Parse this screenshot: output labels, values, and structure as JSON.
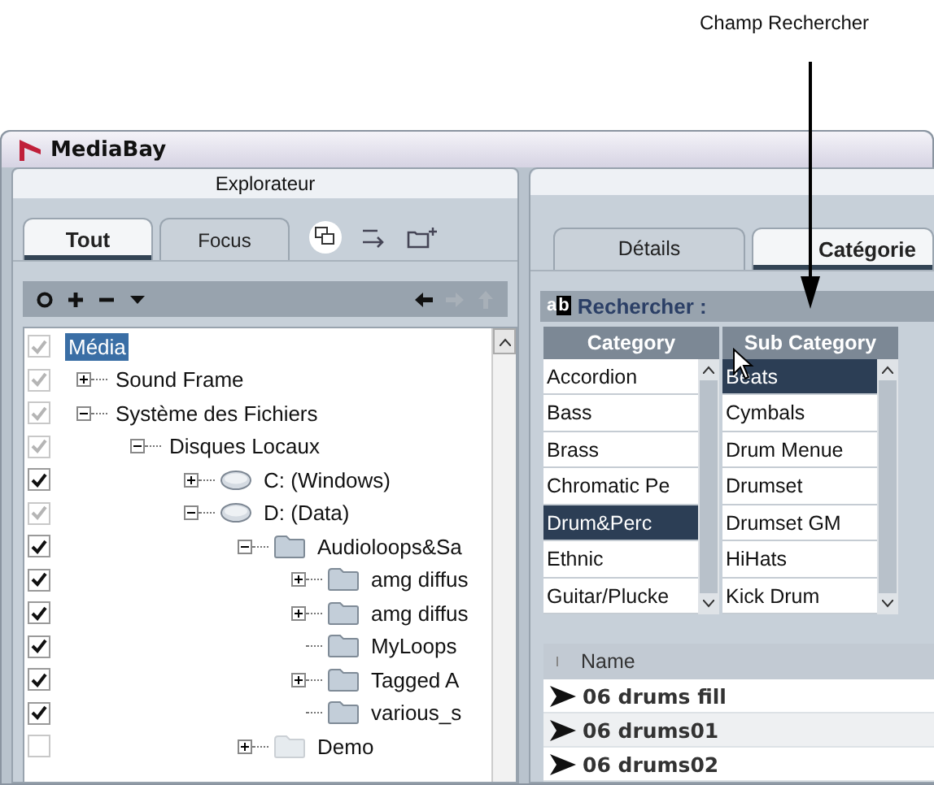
{
  "callout": {
    "label": "Champ Rechercher"
  },
  "window": {
    "title": "MediaBay"
  },
  "explorer": {
    "title": "Explorateur",
    "tabs": [
      {
        "label": "Tout",
        "selected": true
      },
      {
        "label": "Focus",
        "selected": false
      }
    ],
    "toolbar": [
      {
        "kind": "circle",
        "disabled": false
      },
      {
        "kind": "plus",
        "disabled": false
      },
      {
        "kind": "minus",
        "disabled": false
      },
      {
        "kind": "caret",
        "disabled": false
      },
      {
        "kind": "left",
        "disabled": false
      },
      {
        "kind": "right",
        "disabled": true
      },
      {
        "kind": "up",
        "disabled": true
      }
    ],
    "tree": [
      {
        "label": "Média",
        "checked": true,
        "disabled": true,
        "selected": true,
        "children": [
          {
            "label": "Sound Frame",
            "checked": true,
            "disabled": true,
            "selected": false,
            "expanded": false
          },
          {
            "label": "Système des Fichiers",
            "checked": true,
            "disabled": true,
            "selected": false,
            "expanded": true,
            "children": [
              {
                "label": "Disques Locaux",
                "checked": true,
                "disabled": true,
                "selected": false,
                "expanded": true,
                "children": [
                  {
                    "label": "C: (Windows)",
                    "kind": "drive",
                    "checked": true,
                    "disabled": false,
                    "selected": false,
                    "expanded": false
                  },
                  {
                    "label": "D: (Data)",
                    "kind": "drive",
                    "checked": true,
                    "disabled": true,
                    "selected": false,
                    "expanded": true,
                    "children": [
                      {
                        "label": "Audioloops&Sa",
                        "kind": "folder",
                        "checked": true,
                        "disabled": false,
                        "selected": false,
                        "expanded": true,
                        "children": [
                          {
                            "label": "amg diffus",
                            "kind": "folder",
                            "checked": true,
                            "disabled": false,
                            "selected": false,
                            "expanded": false
                          },
                          {
                            "label": "amg diffus",
                            "kind": "folder",
                            "checked": true,
                            "disabled": false,
                            "selected": false,
                            "expanded": false
                          },
                          {
                            "label": "MyLoops",
                            "kind": "folder",
                            "checked": true,
                            "disabled": false,
                            "selected": false
                          },
                          {
                            "label": "Tagged A",
                            "kind": "folder",
                            "checked": true,
                            "disabled": false,
                            "selected": false,
                            "expanded": false
                          },
                          {
                            "label": "various_s",
                            "kind": "folder",
                            "checked": true,
                            "disabled": false,
                            "selected": false
                          }
                        ]
                      },
                      {
                        "label": "Demo",
                        "kind": "folder",
                        "checked": false,
                        "disabled": true,
                        "selected": false,
                        "expanded": false
                      }
                    ]
                  }
                ]
              }
            ]
          }
        ]
      }
    ]
  },
  "browser": {
    "tabs": [
      {
        "label": "Détails",
        "selected": false
      },
      {
        "label": "Catégorie",
        "selected": true
      }
    ],
    "search": {
      "icon_letters": [
        "a",
        "b"
      ],
      "label": "Rechercher :"
    },
    "category": {
      "header": "Category",
      "items": [
        {
          "label": "Accordion",
          "selected": false
        },
        {
          "label": "Bass",
          "selected": false
        },
        {
          "label": "Brass",
          "selected": false
        },
        {
          "label": "Chromatic Pe",
          "selected": false
        },
        {
          "label": "Drum&Perc",
          "selected": true
        },
        {
          "label": "Ethnic",
          "selected": false
        },
        {
          "label": "Guitar/Plucke",
          "selected": false
        }
      ]
    },
    "sub_category": {
      "header": "Sub Category",
      "items": [
        {
          "label": "Beats",
          "selected": true
        },
        {
          "label": "Cymbals",
          "selected": false
        },
        {
          "label": "Drum Menue",
          "selected": false
        },
        {
          "label": "Drumset",
          "selected": false
        },
        {
          "label": "Drumset GM",
          "selected": false
        },
        {
          "label": "HiHats",
          "selected": false
        },
        {
          "label": "Kick Drum",
          "selected": false
        }
      ]
    },
    "results": {
      "columns": [
        "Name"
      ],
      "rows": [
        {
          "name": "06 drums fill"
        },
        {
          "name": "06 drums01"
        },
        {
          "name": "06 drums02"
        }
      ]
    }
  }
}
